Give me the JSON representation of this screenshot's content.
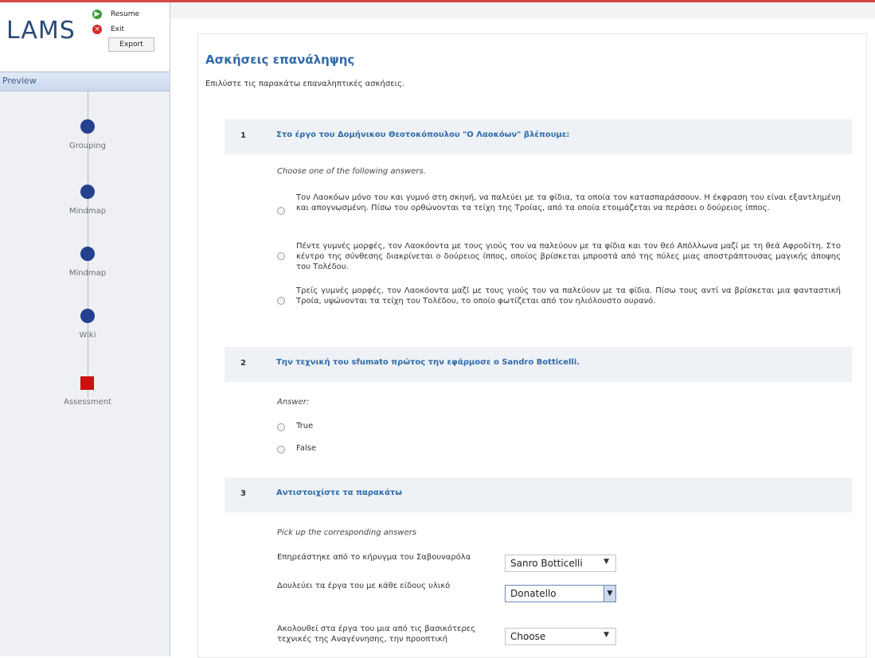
{
  "app": {
    "logo": "LAMS",
    "resume_label": "Resume",
    "exit_label": "Exit",
    "export_label": "Export",
    "preview_label": "Preview"
  },
  "sequence": [
    {
      "label": "Grouping",
      "type": "circle"
    },
    {
      "label": "Mindmap",
      "type": "circle"
    },
    {
      "label": "Mindmap",
      "type": "circle"
    },
    {
      "label": "Wiki",
      "type": "circle"
    },
    {
      "label": "Assessment",
      "type": "square"
    }
  ],
  "page": {
    "title": "Ασκήσεις επανάληψης",
    "subtitle": "Επιλύστε τις παρακάτω επαναληπτικές ασκήσεις."
  },
  "q1": {
    "num": "1",
    "text": "Στο έργο του Δομήνικου Θεοτοκόπουλου \"Ο Λαοκόων\" βλέπουμε:",
    "instruction": "Choose one of the following answers.",
    "options": [
      "Τον Λαοκόων μόνο του και γυμνό στη σκηνή, να παλεύει με τα φίδια, τα οποία τον κατασπαράσσουν. Η έκφραση του είναι εξαντλημένη και απογνωσμένη. Πίσω του ορθώνονται τα τείχη της Τροίας, από τα οποία ετοιμάζεται να περάσει ο δούρειος ίππος.",
      "Πέντε γυμνές μορφές, τον Λαοκόοντα με τους γιούς του να παλεύουν με τα φίδια και τον θεό Απόλλωνα μαζί με τη θεά Αφροδίτη. Στο κέντρο της σύνθεσης διακρίνεται ο δούρειος ίππος, οποίος βρίσκεται μπροστά από της πύλες μιας αποστράπτουσας μαγικής άποψης του Τολέδου.",
      "Τρείς γυμνές μορφές, τον Λαοκόοντα μαζί με τους γιούς του να παλεύουν με τα φίδια. Πίσω τους αντί να βρίσκεται μια φανταστική Τροία, υψώνονται τα τείχη του Τολέδου, το οποίο φωτίζεται από τον ηλιόλουστο ουρανό."
    ]
  },
  "q2": {
    "num": "2",
    "text": "Την τεχνική του sfumato πρώτος την εφάρμοσε ο Sandro Botticelli.",
    "instruction": "Answer:",
    "true_label": "True",
    "false_label": "False"
  },
  "q3": {
    "num": "3",
    "text": "Αντιστοιχίστε τα παρακάτω",
    "instruction": "Pick up the corresponding answers",
    "rows": [
      {
        "label": "Επηρεάστηκε από το κήρυγμα του Σαβουναρόλα",
        "value": "Sanro Botticelli"
      },
      {
        "label": "Δουλεύει τα έργα του με κάθε είδους υλικό",
        "value": "Donatello"
      },
      {
        "label": "Ακολουθεί στα έργα του μια από τις βασικότερες τεχνικές της Αναγέννησης, την προοπτική",
        "value": "Choose"
      }
    ]
  }
}
